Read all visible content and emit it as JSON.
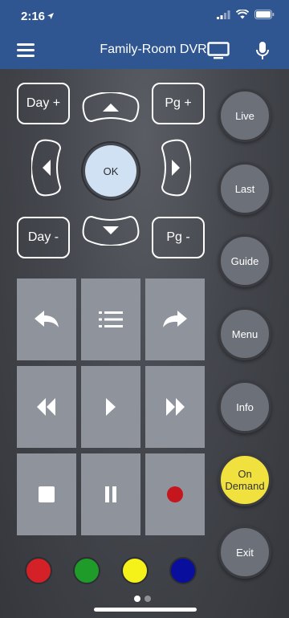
{
  "status_bar": {
    "time": "2:16"
  },
  "nav": {
    "title": "Family-Room DVR"
  },
  "dpad": {
    "day_up": "Day +",
    "day_down": "Day -",
    "page_up": "Pg +",
    "page_down": "Pg -",
    "ok": "OK"
  },
  "side_buttons": {
    "live": "Live",
    "last": "Last",
    "guide": "Guide",
    "menu": "Menu",
    "info": "Info",
    "on_demand_line1": "On",
    "on_demand_line2": "Demand",
    "exit": "Exit"
  },
  "icons": [
    "hamburger-icon",
    "tv-icon",
    "mic-icon",
    "arrow-up-icon",
    "arrow-down-icon",
    "arrow-left-icon",
    "arrow-right-icon",
    "back-icon",
    "list-icon",
    "forward-icon",
    "rewind-icon",
    "play-icon",
    "fast-forward-icon",
    "stop-icon",
    "pause-icon",
    "record-icon"
  ],
  "color_keys": {
    "red": "#d42027",
    "green": "#1f9b2a",
    "yellow": "#f5f21a",
    "blue": "#0a0e9c"
  },
  "colors": {
    "header": "#2f5690",
    "ok": "#cfe1f3",
    "side_button": "#6c7079",
    "on_demand": "#f0e13e",
    "tile": "#8f939c",
    "record": "#c4161c"
  },
  "pager": {
    "page": 1,
    "pages": 2
  }
}
